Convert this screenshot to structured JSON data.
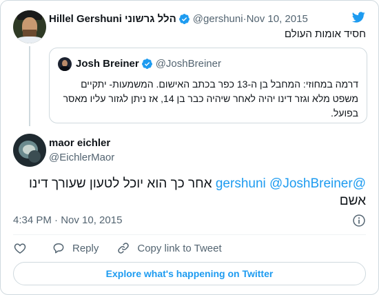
{
  "colors": {
    "accent": "#1d9bf0",
    "text": "#0f1419",
    "muted": "#536471",
    "border": "#cfd9de"
  },
  "parent_tweet": {
    "display_name": "Hillel Gershuni הלל גרשוני",
    "handle": "@gershuni",
    "date": "Nov 10, 2015",
    "separator": "·",
    "text": "חסיד אומות העולם"
  },
  "quoted_tweet": {
    "display_name": "Josh Breiner",
    "handle": "@JoshBreiner",
    "text": "דרמה במחוזי: המחבל בן ה-13 כפר בכתב האישום. המשמעות- יתקיים משפט מלא וגזר דינו יהיה לאחר שיהיה כבר בן 14, אז ניתן לגזור עליו מאסר בפועל."
  },
  "reply_tweet": {
    "display_name": "maor eichler",
    "handle": "@EichlerMaor",
    "mention_1": "@gershuni",
    "mention_2": "@JoshBreiner",
    "text": "אחר כך הוא יוכל לטעון שעורך דינו אשם",
    "timestamp": "4:34 PM · Nov 10, 2015"
  },
  "actions": {
    "reply_label": "Reply",
    "copy_link_label": "Copy link to Tweet"
  },
  "icons": {
    "brand": "twitter-bird-icon",
    "verified": "verified-badge-icon",
    "info": "info-icon",
    "like": "heart-icon",
    "reply": "speech-bubble-icon",
    "copy_link": "link-icon"
  },
  "explore_button_label": "Explore what's happening on Twitter"
}
